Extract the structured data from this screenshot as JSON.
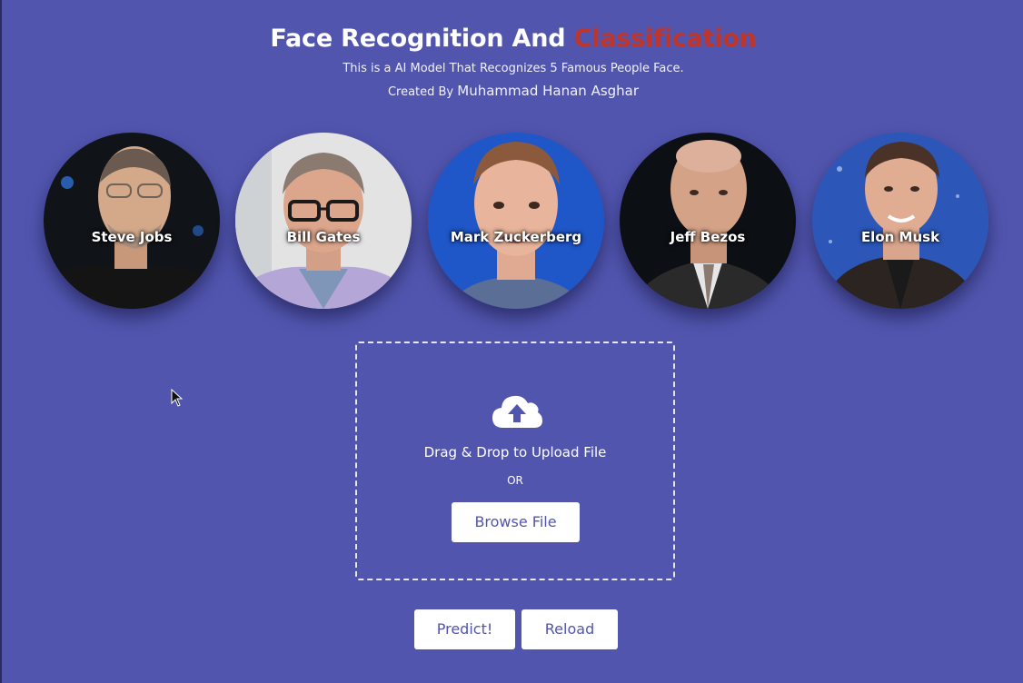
{
  "header": {
    "title_main": "Face Recognition And",
    "title_accent": "Classification",
    "subtitle": "This is a AI Model That Recognizes 5 Famous People Face.",
    "credit_prefix": "Created By",
    "credit_author": "Muhammad Hanan Asghar"
  },
  "faces": [
    {
      "name": "Steve Jobs"
    },
    {
      "name": "Bill Gates"
    },
    {
      "name": "Mark Zuckerberg"
    },
    {
      "name": "Jeff Bezos"
    },
    {
      "name": "Elon Musk"
    }
  ],
  "upload": {
    "icon": "cloud-upload-icon",
    "drop_text": "Drag & Drop to Upload File",
    "or_text": "OR",
    "browse_label": "Browse File"
  },
  "actions": {
    "predict_label": "Predict!",
    "reload_label": "Reload"
  },
  "colors": {
    "background": "#5155ae",
    "accent": "#c0352a",
    "button_bg": "#ffffff",
    "button_text": "#5155ae"
  }
}
